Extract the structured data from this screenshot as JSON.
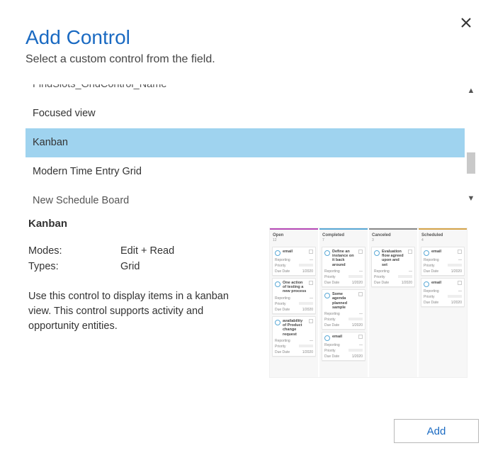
{
  "header": {
    "title": "Add Control",
    "subtitle": "Select a custom control from the field."
  },
  "list": {
    "items": [
      "FindSlots_GridControl_Name",
      "Focused view",
      "Kanban",
      "Modern Time Entry Grid",
      "New Schedule Board"
    ],
    "selected_index": 2
  },
  "details": {
    "title": "Kanban",
    "modes_label": "Modes:",
    "modes_value": "Edit + Read",
    "types_label": "Types:",
    "types_value": "Grid",
    "description": "Use this control to display items in a kanban view. This control supports activity and opportunity entities."
  },
  "preview": {
    "columns": [
      {
        "name": "Open",
        "count": "12",
        "color": "#b84bb8"
      },
      {
        "name": "Completed",
        "count": "7",
        "color": "#5aa9d6"
      },
      {
        "name": "Canceled",
        "count": "3",
        "color": "#8a8a8a"
      },
      {
        "name": "Scheduled",
        "count": "4",
        "color": "#d6a54b"
      }
    ],
    "card_labels": {
      "reporting": "Reporting",
      "priority": "Priority",
      "due": "Due Date"
    },
    "col0_cards": [
      {
        "title": "email"
      },
      {
        "title": "One action of testing a new process"
      },
      {
        "title": "availability of Product change request"
      }
    ],
    "col1_cards": [
      {
        "title": "Define an instance on it back around"
      },
      {
        "title": "Some agenda planned sample"
      },
      {
        "title": "email"
      }
    ],
    "col2_cards": [
      {
        "title": "Evaluation flow agreed upon and set"
      }
    ],
    "col3_cards": [
      {
        "title": "email"
      },
      {
        "title": "email"
      }
    ]
  },
  "footer": {
    "add_label": "Add"
  }
}
